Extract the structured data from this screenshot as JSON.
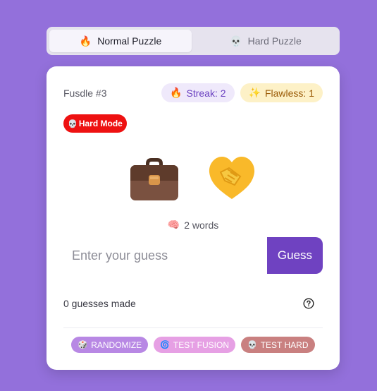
{
  "tabs": [
    {
      "icon": "fire-icon",
      "glyph": "🔥",
      "label": "Normal Puzzle",
      "active": true
    },
    {
      "icon": "skull-icon",
      "glyph": "💀",
      "label": "Hard Puzzle",
      "active": false
    }
  ],
  "card": {
    "puzzle_title": "Fusdle #3",
    "streak": {
      "icon": "fire-icon",
      "glyph": "🔥",
      "label": "Streak: 2"
    },
    "flawless": {
      "icon": "sparkles-icon",
      "glyph": "✨",
      "label": "Flawless: 1"
    },
    "hard_mode": {
      "icon": "skull-icon",
      "glyph": "💀",
      "label": "Hard Mode"
    },
    "emojis": [
      {
        "name": "briefcase",
        "icon": "briefcase-icon"
      },
      {
        "name": "handshake",
        "icon": "handshake-icon"
      }
    ],
    "hint": {
      "icon": "brain-icon",
      "glyph": "🧠",
      "label": "2 words"
    },
    "guess": {
      "placeholder": "Enter your guess",
      "value": "",
      "button_label": "Guess"
    },
    "guesses_made": "0 guesses made",
    "help_icon": "question-circle-icon"
  },
  "actions": [
    {
      "icon": "dice-icon",
      "glyph": "🎲",
      "label": "RANDOMIZE"
    },
    {
      "icon": "cyclone-icon",
      "glyph": "🌀",
      "label": "TEST FUSION"
    },
    {
      "icon": "skull-icon",
      "glyph": "💀",
      "label": "TEST HARD"
    }
  ],
  "colors": {
    "background": "#9370db",
    "accent": "#6f42c1",
    "hard_mode": "#ee1111",
    "streak_bg": "#efe9fb",
    "flawless_bg": "#fdf1c7"
  }
}
